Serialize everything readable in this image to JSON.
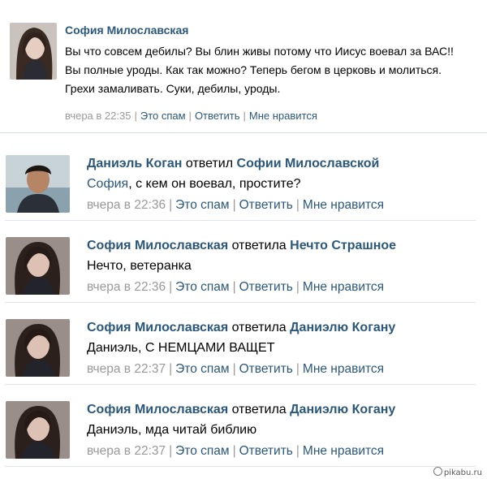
{
  "post": {
    "author": "София Милославская",
    "text": "Вы что совсем дебилы? Вы блин живы потому что Иисус воевал за ВАС!! Вы полные уроды. Как так можно? Теперь бегом в церковь и молиться. Грехи замаливать. Суки, дебилы, уроды.",
    "time": "вчера в 22:35",
    "spam": "Это спам",
    "reply": "Ответить",
    "like": "Мне нравится"
  },
  "replies": [
    {
      "author": "Даниэль Коган",
      "verb": "ответил",
      "target": "Софии Милославской",
      "addressee": "София",
      "text": ", с кем он воевал, простите?",
      "time": "вчера в 22:36",
      "spam": "Это спам",
      "reply": "Ответить",
      "like": "Мне нравится"
    },
    {
      "author": "София Милославская",
      "verb": "ответила",
      "target": "Нечто Страшное",
      "addressee": "",
      "text": "Нечто, ветеранка",
      "time": "вчера в 22:36",
      "spam": "Это спам",
      "reply": "Ответить",
      "like": "Мне нравится"
    },
    {
      "author": "София Милославская",
      "verb": "ответила",
      "target": "Даниэлю Когану",
      "addressee": "",
      "text": "Даниэль, С НЕМЦАМИ ВАЩЕТ",
      "time": "вчера в 22:37",
      "spam": "Это спам",
      "reply": "Ответить",
      "like": "Мне нравится"
    },
    {
      "author": "София Милославская",
      "verb": "ответила",
      "target": "Даниэлю Когану",
      "addressee": "",
      "text": "Даниэль, мда читай библию",
      "time": "вчера в 22:37",
      "spam": "Это спам",
      "reply": "Ответить",
      "like": "Мне нравится"
    }
  ],
  "watermark": "pikabu.ru",
  "colors": {
    "link": "#2b587a",
    "meta": "#999999",
    "divider": "#e1e5eb"
  }
}
